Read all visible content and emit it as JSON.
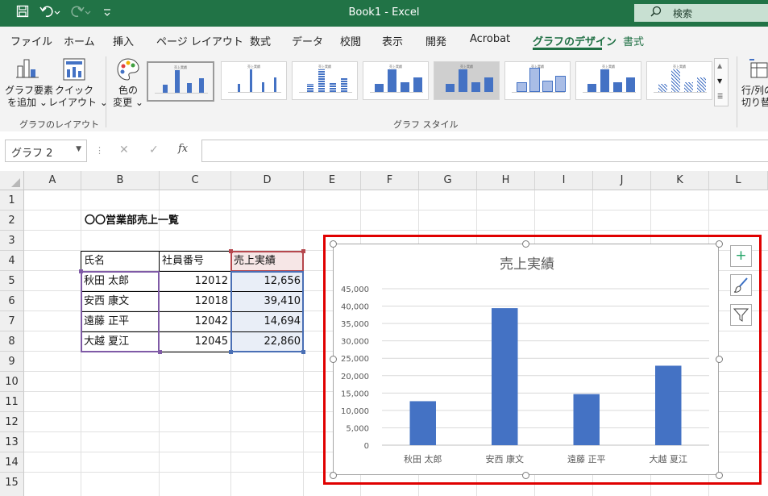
{
  "window": {
    "title": "Book1  -  Excel",
    "search_placeholder": "検索",
    "qat": {
      "save_icon": "save-icon",
      "undo_icon": "undo-icon",
      "redo_icon": "redo-icon",
      "customize_icon": "customize-icon"
    }
  },
  "menu": {
    "tabs": [
      "ファイル",
      "ホーム",
      "挿入",
      "ページ レイアウト",
      "数式",
      "データ",
      "校閲",
      "表示",
      "開発",
      "Acrobat",
      "グラフのデザイン",
      "書式"
    ],
    "active": "グラフのデザイン"
  },
  "ribbon": {
    "add_element": "グラフ要素\nを追加 ⌄",
    "quick_layout": "クイック\nレイアウト ⌄",
    "change_colors": "色の\n変更 ⌄",
    "group_layout": "グラフのレイアウト",
    "group_styles": "グラフ スタイル",
    "switch_row_col": "行/列の\n切り替え"
  },
  "formula_bar": {
    "name_box": "グラフ 2",
    "cancel": "✕",
    "enter": "✓",
    "fx": "fx",
    "value": ""
  },
  "grid": {
    "columns": [
      "A",
      "B",
      "C",
      "D",
      "E",
      "F",
      "G",
      "H",
      "I",
      "J",
      "K",
      "L"
    ],
    "rows": [
      "1",
      "2",
      "3",
      "4",
      "5",
      "6",
      "7",
      "8",
      "9",
      "10",
      "11",
      "12",
      "13",
      "14",
      "15"
    ],
    "sheet_title": "〇〇営業部売上一覧",
    "headers": [
      "氏名",
      "社員番号",
      "売上実績"
    ],
    "data": [
      [
        "秋田 太郎",
        "12012",
        "12,656"
      ],
      [
        "安西 康文",
        "12018",
        "39,410"
      ],
      [
        "遠藤 正平",
        "12042",
        "14,694"
      ],
      [
        "大越 夏江",
        "12045",
        "22,860"
      ]
    ]
  },
  "chart_data": {
    "type": "bar",
    "title": "売上実績",
    "categories": [
      "秋田 太郎",
      "安西 康文",
      "遠藤 正平",
      "大越 夏江"
    ],
    "series": [
      {
        "values": [
          12656,
          39410,
          14694,
          22860
        ]
      }
    ],
    "ylim": [
      0,
      45000
    ],
    "yticks": [
      "45,000",
      "40,000",
      "35,000",
      "30,000",
      "25,000",
      "20,000",
      "15,000",
      "10,000",
      "5,000",
      "0"
    ],
    "grid": true,
    "color": "#4472c4"
  },
  "chart_tools": {
    "add_element": "+",
    "styles": "brush",
    "filter": "filter"
  },
  "colors": {
    "title_bar": "#217346",
    "accent_tab": "#1e6f43",
    "highlight_box": "#e00000",
    "bar": "#4472c4"
  }
}
